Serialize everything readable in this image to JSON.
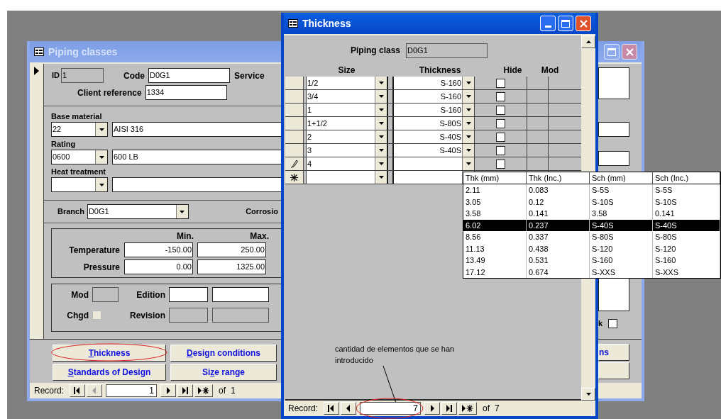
{
  "piping_window": {
    "title": "Piping classes",
    "active": false,
    "id": {
      "label": "ID",
      "value": "1"
    },
    "code": {
      "label": "Code",
      "value": "D0G1"
    },
    "service": {
      "label": "Service"
    },
    "client_reference": {
      "label": "Client reference",
      "value": "1334"
    },
    "base_material": {
      "label": "Base material",
      "code": "22",
      "name": "AISI 316"
    },
    "rating": {
      "label": "Rating",
      "code": "0600",
      "name": "600 LB"
    },
    "heat_treatment": {
      "label": "Heat treatment"
    },
    "branch": {
      "label": "Branch",
      "value": "D0G1"
    },
    "corrosion": {
      "label": "Corrosio"
    },
    "limits": {
      "columns": [
        "Min.",
        "Max."
      ],
      "rows": [
        {
          "label": "Temperature",
          "min": "-150.00",
          "max": "250.00"
        },
        {
          "label": "Pressure",
          "min": "0.00",
          "max": "1325.00"
        }
      ]
    },
    "revision_box": {
      "mod_label": "Mod",
      "chgd": {
        "label": "Chgd",
        "checked": false
      },
      "edition_label": "Edition",
      "revision_label": "Revision"
    },
    "buttons": [
      {
        "key": "T",
        "after": "hickness",
        "highlighted": true
      },
      {
        "key": "D",
        "after": "esign conditions",
        "highlighted": false
      },
      {
        "key": "S",
        "after": "tandards of Design",
        "highlighted": false
      },
      {
        "before": "Si",
        "key": "z",
        "after": "e range",
        "highlighted": false
      }
    ],
    "right_column": {
      "check_label": "k",
      "checked": false,
      "buttons": [
        {
          "kind": "labeled",
          "label": "ns"
        },
        {
          "kind": "blank"
        }
      ]
    },
    "record_nav": {
      "label": "Record:",
      "current": "1",
      "of": "of",
      "total": "1",
      "highlighted": false,
      "buttons": [
        {
          "kind": "first",
          "disabled": false
        },
        {
          "kind": "prev",
          "disabled": true
        },
        {
          "kind": "next",
          "disabled": false
        },
        {
          "kind": "last",
          "disabled": false
        },
        {
          "kind": "new",
          "disabled": false
        }
      ]
    }
  },
  "thickness_window": {
    "title": "Thickness",
    "active": true,
    "piping_class": {
      "label": "Piping class",
      "value": "D0G1"
    },
    "columns": [
      "Size",
      "Thickness",
      "Hide",
      "Mod"
    ],
    "rows": [
      {
        "kind": "saved",
        "size": "1/2",
        "thickness": "S-160",
        "hide": false
      },
      {
        "kind": "saved",
        "size": "3/4",
        "thickness": "S-160",
        "hide": false
      },
      {
        "kind": "saved",
        "size": "1",
        "thickness": "S-160",
        "hide": false
      },
      {
        "kind": "saved",
        "size": "1+1/2",
        "thickness": "S-80S",
        "hide": false
      },
      {
        "kind": "saved",
        "size": "2",
        "thickness": "S-40S",
        "hide": false
      },
      {
        "kind": "saved",
        "size": "3",
        "thickness": "S-40S",
        "hide": false
      },
      {
        "kind": "editing",
        "size": "4",
        "hide": false
      },
      {
        "kind": "new"
      }
    ],
    "annotation": "cantidad de elementos que se han introducido",
    "record_nav": {
      "label": "Record:",
      "current": "7",
      "of": "of",
      "total": "7",
      "highlighted": true,
      "buttons": [
        {
          "kind": "first",
          "disabled": false
        },
        {
          "kind": "prev",
          "disabled": false
        },
        {
          "kind": "next",
          "disabled": false
        },
        {
          "kind": "last",
          "disabled": false
        },
        {
          "kind": "new",
          "disabled": false
        }
      ]
    }
  },
  "dropdown_list": {
    "columns": [
      "Thk (mm)",
      "Thk (Inc.)",
      "Sch (mm)",
      "Sch (Inc.)"
    ],
    "rows": [
      {
        "cells": [
          "2.11",
          "0.083",
          "S-5S",
          "S-5S"
        ],
        "selected": false
      },
      {
        "cells": [
          "3.05",
          "0.12",
          "S-10S",
          "S-10S"
        ],
        "selected": false
      },
      {
        "cells": [
          "3.58",
          "0.141",
          "3.58",
          "0.141"
        ],
        "selected": false
      },
      {
        "cells": [
          "6.02",
          "0.237",
          "S-40S",
          "S-40S"
        ],
        "selected": true
      },
      {
        "cells": [
          "8.56",
          "0.337",
          "S-80S",
          "S-80S"
        ],
        "selected": false
      },
      {
        "cells": [
          "11.13",
          "0.438",
          "S-120",
          "S-120"
        ],
        "selected": false
      },
      {
        "cells": [
          "13.49",
          "0.531",
          "S-160",
          "S-160"
        ],
        "selected": false
      },
      {
        "cells": [
          "17.12",
          "0.674",
          "S-XXS",
          "S-XXS"
        ],
        "selected": false
      }
    ]
  }
}
